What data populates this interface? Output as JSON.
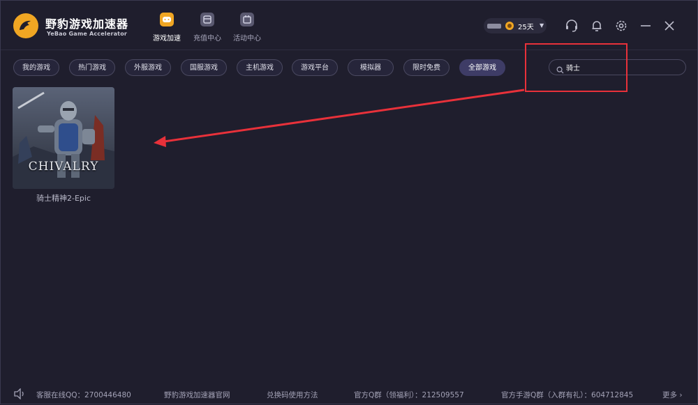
{
  "app": {
    "title": "野豹游戏加速器",
    "subtitle": "YeBao Game Accelerator",
    "brand_color": "#f0a623"
  },
  "nav": {
    "tabs": [
      {
        "label": "游戏加速",
        "icon": "gamepad-icon",
        "active": true
      },
      {
        "label": "充值中心",
        "icon": "wallet-icon",
        "active": false
      },
      {
        "label": "活动中心",
        "icon": "calendar-icon",
        "active": false
      }
    ]
  },
  "user": {
    "days_left": "25天"
  },
  "header_icons": [
    "headset-icon",
    "bell-icon",
    "gear-icon",
    "minimize-icon",
    "close-icon"
  ],
  "filters": [
    {
      "label": "我的游戏",
      "active": false
    },
    {
      "label": "热门游戏",
      "active": false
    },
    {
      "label": "外服游戏",
      "active": false
    },
    {
      "label": "国服游戏",
      "active": false
    },
    {
      "label": "主机游戏",
      "active": false
    },
    {
      "label": "游戏平台",
      "active": false
    },
    {
      "label": "模拟器",
      "active": false
    },
    {
      "label": "限时免费",
      "active": false
    },
    {
      "label": "全部游戏",
      "active": true
    }
  ],
  "search": {
    "value": "骑士",
    "icon": "search-icon"
  },
  "games": [
    {
      "name": "骑士精神2-Epic",
      "cover_text": "CHIVALRY"
    }
  ],
  "footer": {
    "speaker_icon": "speaker-icon",
    "service_qq": "客服在线QQ：2700446480",
    "official_site": "野豹游戏加速器官网",
    "redeem": "兑换码使用方法",
    "qq_group": "官方Q群（领福利）：212509557",
    "mobile_qq_group": "官方手游Q群（入群有礼）：604712845",
    "more": "更多"
  },
  "annotation_color": "#e8313a"
}
